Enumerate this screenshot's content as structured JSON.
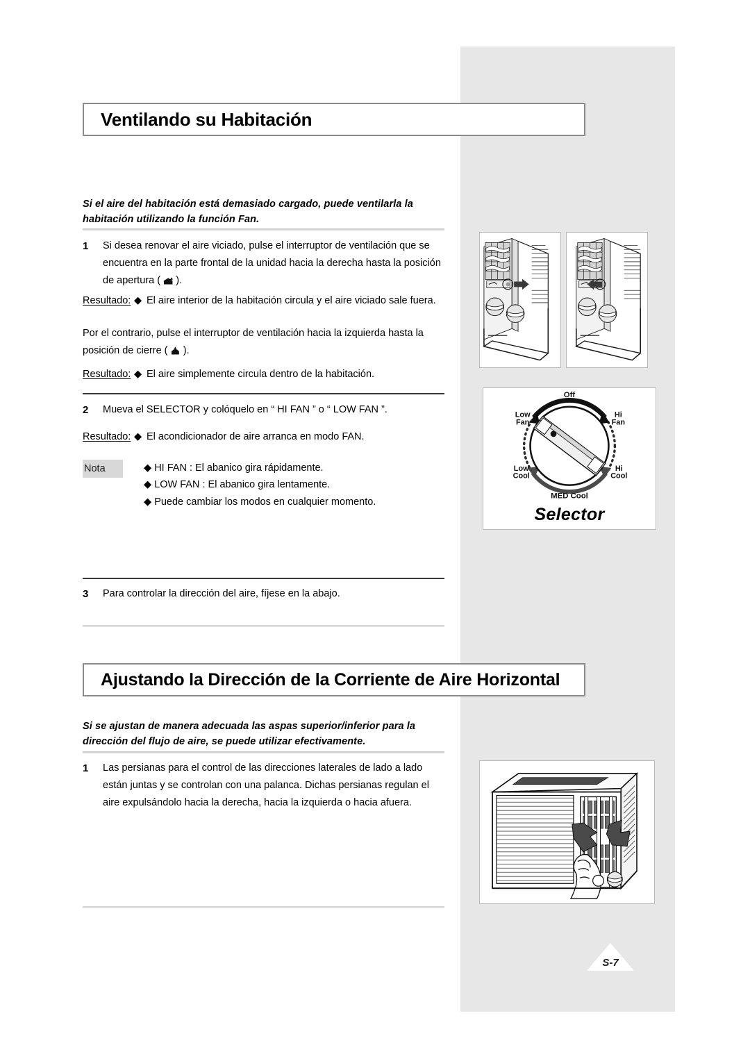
{
  "page": {
    "number_label": "S-7",
    "bg_panel_color": "#e7e7e7"
  },
  "section1": {
    "heading": "Ventilando su Habitación",
    "intro": "Si el aire del habitación está demasiado cargado, puede ventilarla la habitación utilizando la función Fan.",
    "step1": {
      "num": "1",
      "text_before_icon": "Si desea renovar el aire viciado, pulse el interruptor de ventilación que se encuentra en la parte frontal de la unidad hacia la derecha hasta la posición de apertura (",
      "icon": "vent-open-icon",
      "icon_glyph": "❦",
      "text_after_icon": ")."
    },
    "result1": {
      "label": "Resultado:",
      "bullet": "◆",
      "text": "El aire interior de la habitación circula y el aire viciado sale fuera."
    },
    "paragraph": {
      "text_before_icon": "Por el contrario, pulse el interruptor de ventilación hacia la izquierda hasta la posición de cierre (",
      "icon": "vent-close-icon",
      "icon_glyph": "⌂",
      "text_after_icon": ")."
    },
    "result2": {
      "label": "Resultado:",
      "bullet": "◆",
      "text": "El aire simplemente circula dentro de la habitación."
    },
    "step2": {
      "num": "2",
      "text": "Mueva el SELECTOR y colóquelo en “ HI FAN ” o “ LOW FAN ”."
    },
    "result3": {
      "label": "Resultado:",
      "bullet": "◆",
      "text": "El acondicionador de aire arranca en modo FAN."
    },
    "note": {
      "label": "Nota",
      "bullet": "◆",
      "items": [
        "HI FAN : El abanico gira rápidamente.",
        "LOW FAN : El abanico gira lentamente.",
        "Puede cambiar los modos en cualquier momento."
      ]
    },
    "step3": {
      "num": "3",
      "text": "Para controlar la dirección del aire, fíjese en la abajo."
    }
  },
  "section2": {
    "heading": "Ajustando la Dirección de la Corriente de Aire Horizontal",
    "intro": "Si se ajustan de manera adecuada las aspas superior/inferior para la dirección del flujo de aire, se puede utilizar efectivamente.",
    "step1": {
      "num": "1",
      "text": "Las persianas para el control de las direcciones laterales de lado a lado están juntas y se controlan con una palanca. Dichas persianas regulan el aire expulsándolo hacia la derecha, hacia la izquierda o hacia afuera."
    }
  },
  "figures": {
    "vent_open": {
      "name": "ac-front-vent-lever-right-illustration"
    },
    "vent_close": {
      "name": "ac-front-vent-lever-left-illustration"
    },
    "louver": {
      "name": "ac-unit-horizontal-louver-hand-illustration"
    },
    "selector": {
      "name": "selector-dial-illustration",
      "caption": "Selector",
      "labels": {
        "off": "Off",
        "low_fan": "Low\nFan",
        "low_fan_line1": "Low",
        "low_fan_line2": "Fan",
        "hi_fan_line1": "Hi",
        "hi_fan_line2": "Fan",
        "low_cool_line1": "Low",
        "low_cool_line2": "Cool",
        "hi_cool_line1": "Hi",
        "hi_cool_line2": "Cool",
        "med_cool": "MED  Cool"
      }
    }
  }
}
